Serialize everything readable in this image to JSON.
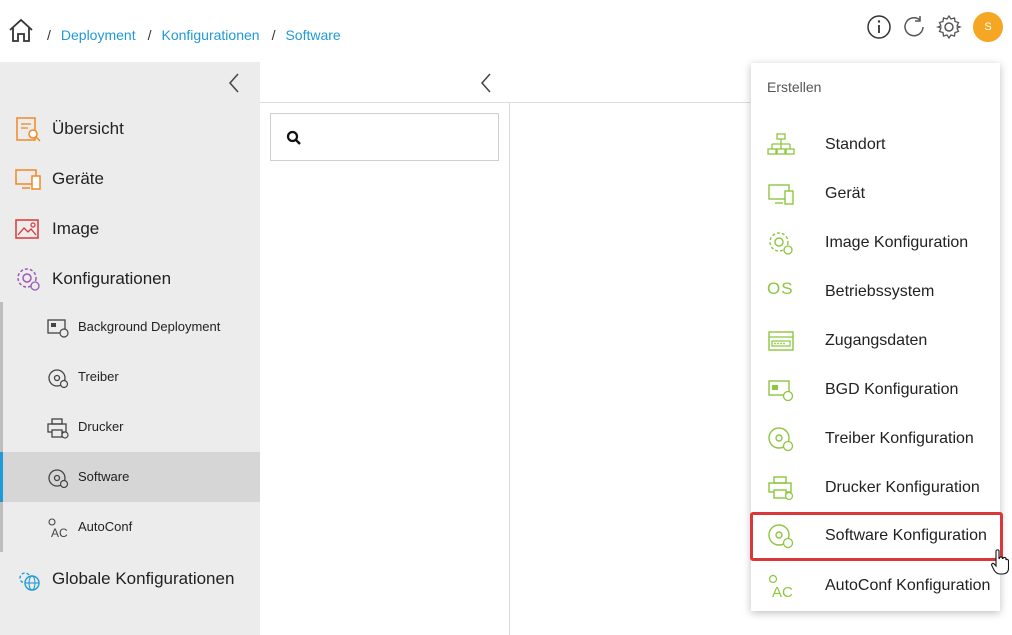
{
  "breadcrumb": {
    "items": [
      "Deployment",
      "Konfigurationen",
      "Software"
    ],
    "separator": "/"
  },
  "header": {
    "avatar_initial": "S",
    "icons": [
      "home-icon",
      "info-icon",
      "refresh-icon",
      "settings-icon"
    ]
  },
  "sidebar": {
    "items": [
      {
        "label": "Übersicht",
        "icon": "overview-icon"
      },
      {
        "label": "Geräte",
        "icon": "devices-icon"
      },
      {
        "label": "Image",
        "icon": "image-icon"
      },
      {
        "label": "Konfigurationen",
        "icon": "configurations-icon"
      }
    ],
    "subitems": [
      {
        "label": "Background Deployment",
        "icon": "background-deployment-icon"
      },
      {
        "label": "Treiber",
        "icon": "driver-icon"
      },
      {
        "label": "Drucker",
        "icon": "printer-icon"
      },
      {
        "label": "Software",
        "icon": "software-icon",
        "active": true
      },
      {
        "label": "AutoConf",
        "icon": "autoconf-icon"
      }
    ],
    "global": {
      "label": "Globale Konfigurationen",
      "icon": "globe-gear-icon"
    }
  },
  "search": {
    "placeholder": "",
    "value": ""
  },
  "create_menu": {
    "title": "Erstellen",
    "items": [
      {
        "label": "Standort",
        "icon": "sitemap-icon"
      },
      {
        "label": "Gerät",
        "icon": "device-icon"
      },
      {
        "label": "Image Konfiguration",
        "icon": "image-config-icon"
      },
      {
        "label": "Betriebssystem",
        "icon": "os-icon",
        "glyph": "OS"
      },
      {
        "label": "Zugangsdaten",
        "icon": "credentials-icon"
      },
      {
        "label": "BGD Konfiguration",
        "icon": "bgd-config-icon"
      },
      {
        "label": "Treiber Konfiguration",
        "icon": "driver-config-icon"
      },
      {
        "label": "Drucker Konfiguration",
        "icon": "printer-config-icon"
      },
      {
        "label": "Software Konfiguration",
        "icon": "software-config-icon",
        "highlighted": true
      },
      {
        "label": "AutoConf Konfiguration",
        "icon": "autoconf-config-icon"
      }
    ]
  },
  "colors": {
    "link": "#1f9ad6",
    "accent_green": "#8dc63f",
    "avatar": "#f5a623",
    "highlight_border": "#d9383a",
    "sidebar_bg": "#ececec",
    "orange_icon": "#f08a24"
  }
}
